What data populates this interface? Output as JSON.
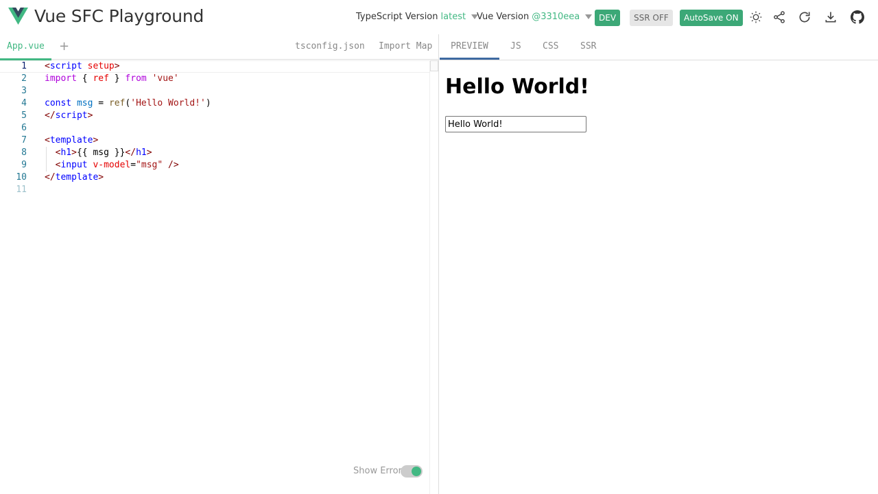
{
  "header": {
    "title": "Vue SFC Playground",
    "ts_version_label": "TypeScript Version",
    "ts_version_value": "latest",
    "vue_version_label": "Vue Version",
    "vue_version_value": "@3310eea",
    "dev_label": "DEV",
    "ssr_label": "SSR OFF",
    "autosave_label": "AutoSave ON",
    "icons": [
      "sun-icon",
      "share-icon",
      "reload-icon",
      "download-icon",
      "github-icon"
    ]
  },
  "editor": {
    "active_file": "App.vue",
    "add_label": "+",
    "aux_tabs": [
      "tsconfig.json",
      "Import Map"
    ],
    "line_numbers": [
      "1",
      "2",
      "3",
      "4",
      "5",
      "6",
      "7",
      "8",
      "9",
      "10",
      "11"
    ],
    "lines": [
      [
        {
          "t": "<",
          "c": "t-ang"
        },
        {
          "t": "script",
          "c": "t-tagname"
        },
        {
          "t": " ",
          "c": "t-plain"
        },
        {
          "t": "setup",
          "c": "t-attr"
        },
        {
          "t": ">",
          "c": "t-ang"
        }
      ],
      [
        {
          "t": "import",
          "c": "t-kw"
        },
        {
          "t": " { ",
          "c": "t-plain"
        },
        {
          "t": "ref",
          "c": "t-attr"
        },
        {
          "t": " } ",
          "c": "t-plain"
        },
        {
          "t": "from",
          "c": "t-kw"
        },
        {
          "t": " ",
          "c": "t-plain"
        },
        {
          "t": "'vue'",
          "c": "t-str"
        }
      ],
      [],
      [
        {
          "t": "const",
          "c": "t-kwb"
        },
        {
          "t": " ",
          "c": "t-plain"
        },
        {
          "t": "msg",
          "c": "t-var"
        },
        {
          "t": " = ",
          "c": "t-plain"
        },
        {
          "t": "ref",
          "c": "t-fn"
        },
        {
          "t": "(",
          "c": "t-plain"
        },
        {
          "t": "'Hello World!'",
          "c": "t-str"
        },
        {
          "t": ")",
          "c": "t-plain"
        }
      ],
      [
        {
          "t": "</",
          "c": "t-ang"
        },
        {
          "t": "script",
          "c": "t-tagname"
        },
        {
          "t": ">",
          "c": "t-ang"
        }
      ],
      [],
      [
        {
          "t": "<",
          "c": "t-ang"
        },
        {
          "t": "template",
          "c": "t-tagname"
        },
        {
          "t": ">",
          "c": "t-ang"
        }
      ],
      [
        {
          "t": "  ",
          "c": "t-plain"
        },
        {
          "t": "<",
          "c": "t-ang"
        },
        {
          "t": "h1",
          "c": "t-tagname"
        },
        {
          "t": ">",
          "c": "t-ang"
        },
        {
          "t": "{{ msg }}",
          "c": "t-plain"
        },
        {
          "t": "</",
          "c": "t-ang"
        },
        {
          "t": "h1",
          "c": "t-tagname"
        },
        {
          "t": ">",
          "c": "t-ang"
        }
      ],
      [
        {
          "t": "  ",
          "c": "t-plain"
        },
        {
          "t": "<",
          "c": "t-ang"
        },
        {
          "t": "input",
          "c": "t-tagname"
        },
        {
          "t": " ",
          "c": "t-plain"
        },
        {
          "t": "v-model",
          "c": "t-attr"
        },
        {
          "t": "=",
          "c": "t-plain"
        },
        {
          "t": "\"msg\"",
          "c": "t-str"
        },
        {
          "t": " />",
          "c": "t-ang"
        }
      ],
      [
        {
          "t": "</",
          "c": "t-ang"
        },
        {
          "t": "template",
          "c": "t-tagname"
        },
        {
          "t": ">",
          "c": "t-ang"
        }
      ],
      []
    ],
    "show_error_label": "Show Error"
  },
  "output": {
    "tabs": [
      "PREVIEW",
      "JS",
      "CSS",
      "SSR"
    ],
    "preview_heading": "Hello World!",
    "preview_input_value": "Hello World!"
  },
  "colors": {
    "accent": "#42b883",
    "button_green": "#3ca877",
    "preview_tab_underline": "#3e6aa1"
  }
}
